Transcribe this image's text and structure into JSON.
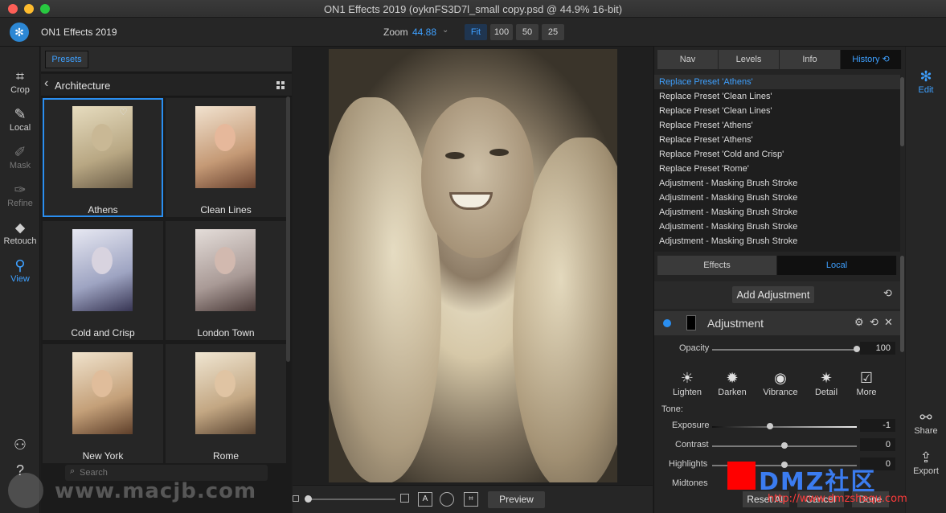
{
  "window": {
    "title": "ON1 Effects 2019 (oyknFS3D7l_small copy.psd @ 44.9% 16-bit)"
  },
  "appbar": {
    "app_name": "ON1 Effects 2019",
    "zoom_label": "Zoom",
    "zoom_value": "44.88",
    "zoom_buttons": [
      "Fit",
      "100",
      "50",
      "25"
    ],
    "zoom_active": "Fit"
  },
  "tools": [
    {
      "label": "Crop",
      "icon": "crop-icon",
      "state": "normal"
    },
    {
      "label": "Local",
      "icon": "brush-icon",
      "state": "normal"
    },
    {
      "label": "Mask",
      "icon": "mask-brush-icon",
      "state": "dim"
    },
    {
      "label": "Refine",
      "icon": "refine-brush-icon",
      "state": "dim"
    },
    {
      "label": "Retouch",
      "icon": "eraser-icon",
      "state": "normal"
    },
    {
      "label": "View",
      "icon": "view-hand-icon",
      "state": "active"
    }
  ],
  "browser": {
    "presets_label": "Presets",
    "category": "Architecture",
    "presets": [
      "Athens",
      "Clean Lines",
      "Cold and Crisp",
      "London Town",
      "New York",
      "Rome"
    ],
    "selected": "Athens",
    "search_placeholder": "Search"
  },
  "bottombar": {
    "preview_label": "Preview",
    "compare_glyph": "A"
  },
  "right": {
    "tabs": [
      "Nav",
      "Levels",
      "Info",
      "History"
    ],
    "active_tab": "History",
    "history": [
      "Replace Preset 'Athens'",
      "Replace Preset 'Clean Lines'",
      "Replace Preset 'Clean Lines'",
      "Replace Preset 'Athens'",
      "Replace Preset 'Athens'",
      "Replace Preset 'Cold and Crisp'",
      "Replace Preset 'Rome'",
      "Adjustment - Masking Brush Stroke",
      "Adjustment - Masking Brush Stroke",
      "Adjustment - Masking Brush Stroke",
      "Adjustment - Masking Brush Stroke",
      "Adjustment - Masking Brush Stroke"
    ],
    "mode_tabs": [
      "Effects",
      "Local"
    ],
    "active_mode": "Local",
    "add_adjustment": "Add Adjustment",
    "adjustment_title": "Adjustment",
    "opacity_label": "Opacity",
    "opacity_value": "100",
    "tone_buttons": [
      "Lighten",
      "Darken",
      "Vibrance",
      "Detail",
      "More"
    ],
    "tone_label": "Tone:",
    "sliders": [
      {
        "label": "Exposure",
        "value": "-1"
      },
      {
        "label": "Contrast",
        "value": "0"
      },
      {
        "label": "Highlights",
        "value": "0"
      },
      {
        "label": "Midtones",
        "value": ""
      }
    ],
    "footer_buttons": [
      "Reset All",
      "Cancel",
      "Done"
    ]
  },
  "rightrail": {
    "edit_label": "Edit",
    "share_label": "Share",
    "export_label": "Export"
  },
  "watermarks": {
    "left": "www.macjb.com",
    "right": "DMZ社区",
    "url": "http://www.dmzshequ.com"
  },
  "colors": {
    "accent": "#3ea0ff",
    "selection": "#2a8ef0",
    "panel": "#242424"
  }
}
